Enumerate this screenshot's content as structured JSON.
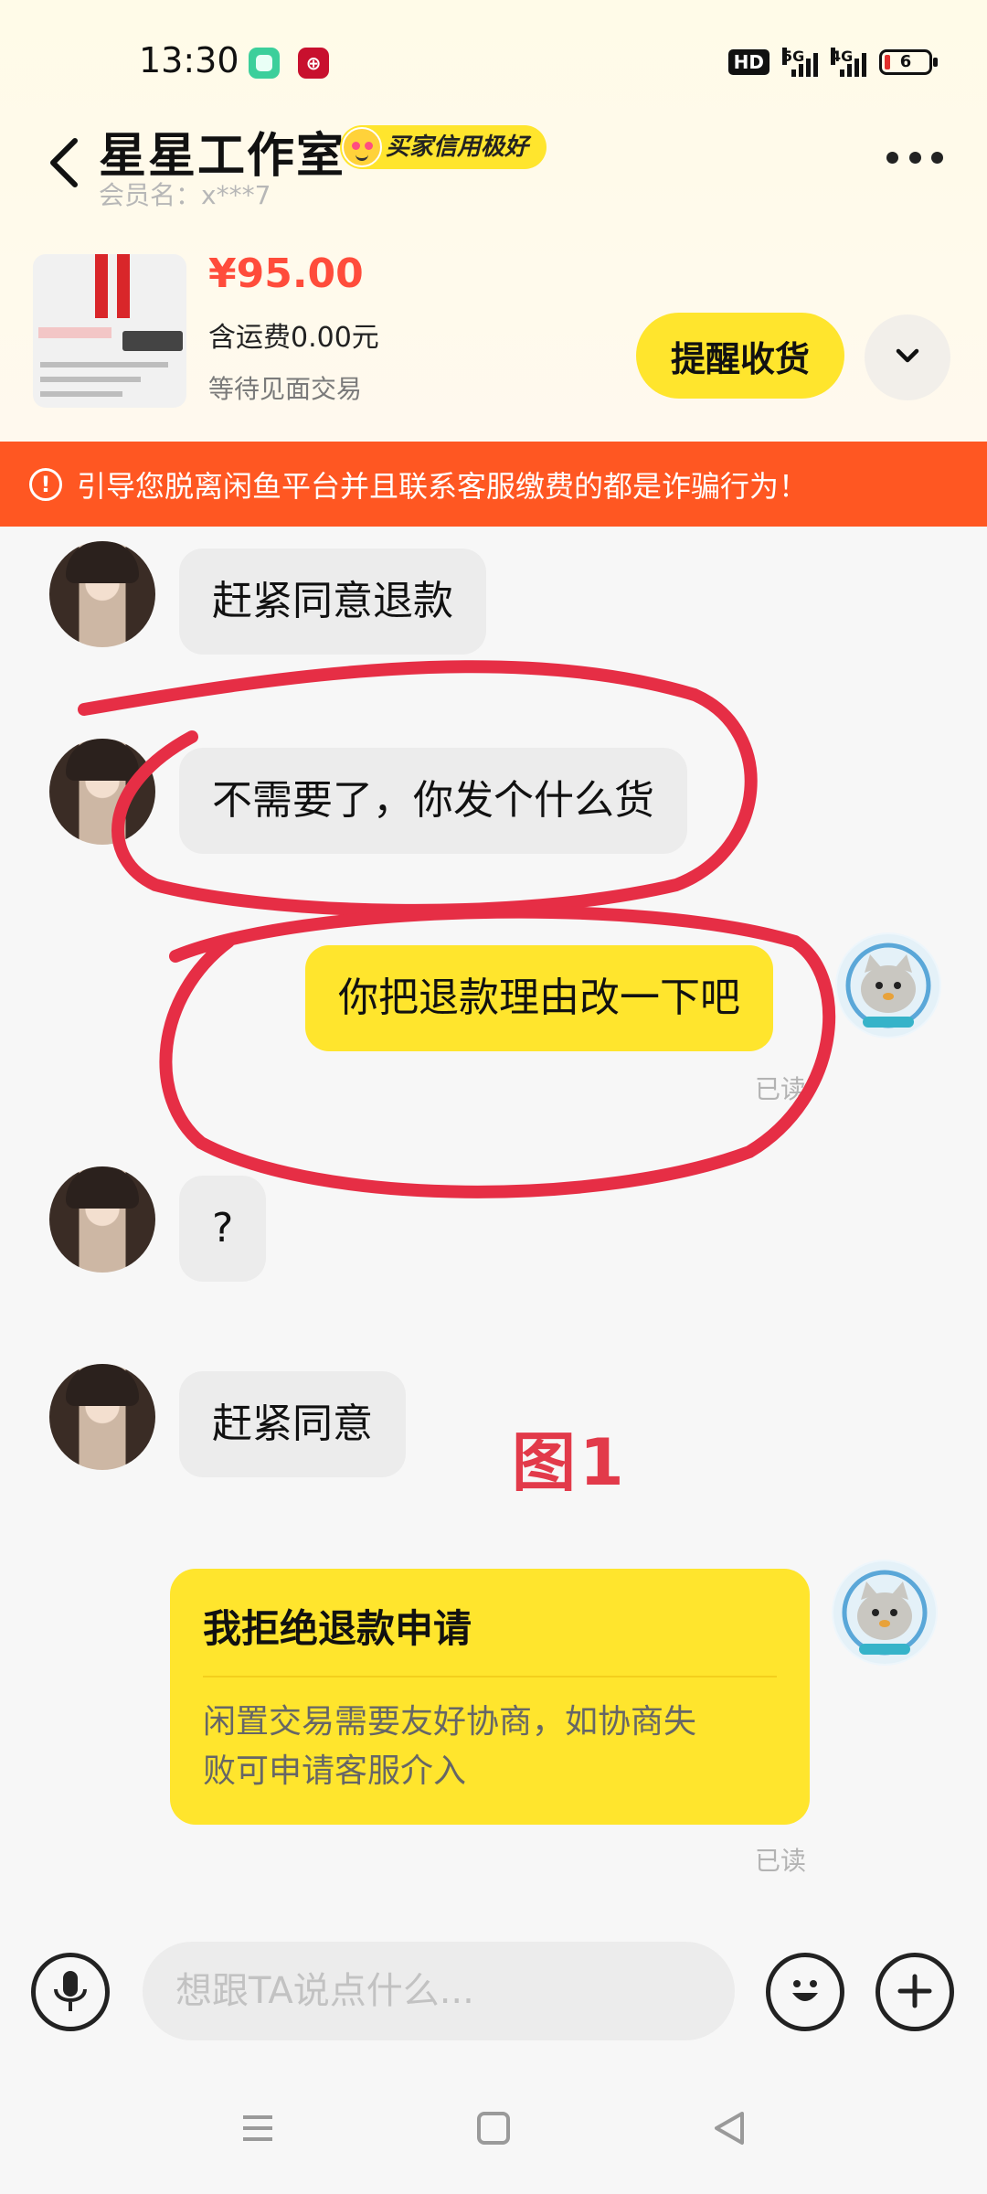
{
  "status_bar": {
    "time": "13:30",
    "hd_label": "HD",
    "network_1": "5G",
    "network_2": "4G",
    "battery_level": "6"
  },
  "header": {
    "title": "星星工作室",
    "credit_badge": "买家信用极好",
    "member_name": "会员名：x***7"
  },
  "product": {
    "price": "¥95.00",
    "shipping": "含运费0.00元",
    "status": "等待见面交易",
    "remind_button": "提醒收货"
  },
  "warning_banner": {
    "icon": "!",
    "text": "引导您脱离闲鱼平台并且联系客服缴费的都是诈骗行为！"
  },
  "messages": [
    {
      "side": "left",
      "text": "赶紧同意退款"
    },
    {
      "side": "left",
      "text": "不需要了，你发个什么货"
    },
    {
      "side": "right",
      "text": "你把退款理由改一下吧",
      "read": "已读"
    },
    {
      "side": "left",
      "text": "?"
    },
    {
      "side": "left",
      "text": "赶紧同意"
    }
  ],
  "refund_card": {
    "title": "我拒绝退款申请",
    "desc_line1": "闲置交易需要友好协商，如协商失",
    "desc_line2": "败可申请客服介入",
    "read": "已读"
  },
  "annotation": {
    "label": "图1",
    "color": "#e23a4a"
  },
  "input_bar": {
    "placeholder": "想跟TA说点什么..."
  },
  "colors": {
    "accent": "#ffe52d",
    "warning": "#ff5722",
    "price": "#ff4c3b"
  }
}
